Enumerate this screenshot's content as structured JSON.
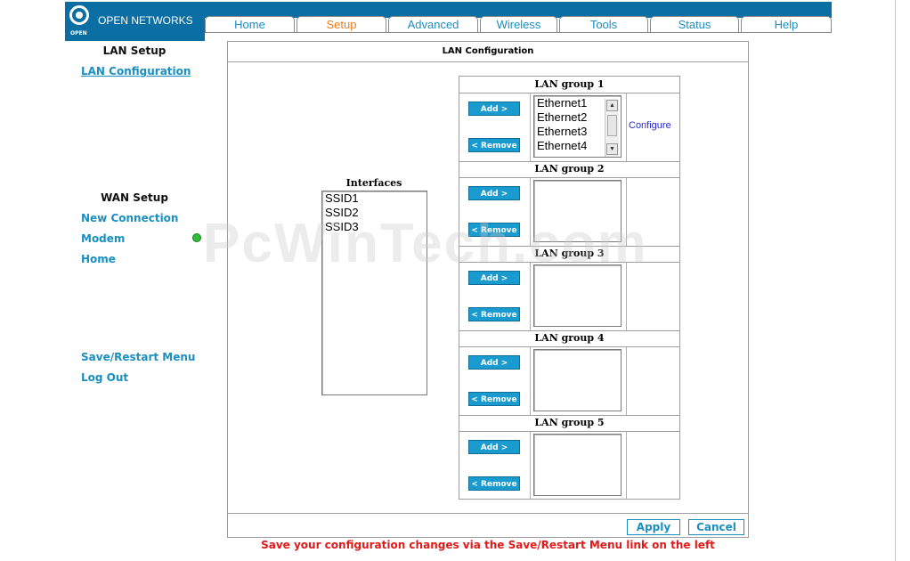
{
  "brand": {
    "name": "OPEN NETWORKS",
    "logo_text": "OPEN"
  },
  "tabs": [
    {
      "label": "Home",
      "active": false
    },
    {
      "label": "Setup",
      "active": true
    },
    {
      "label": "Advanced",
      "active": false
    },
    {
      "label": "Wireless",
      "active": false
    },
    {
      "label": "Tools",
      "active": false
    },
    {
      "label": "Status",
      "active": false
    },
    {
      "label": "Help",
      "active": false
    }
  ],
  "sidebar": {
    "lan_heading": "LAN Setup",
    "lan_configuration": "LAN Configuration",
    "wan_heading": "WAN Setup",
    "new_connection": "New Connection",
    "modem": "Modem",
    "home": "Home",
    "save_restart": "Save/Restart Menu",
    "log_out": "Log Out"
  },
  "main": {
    "title": "LAN Configuration",
    "interfaces_title": "Interfaces",
    "interfaces": [
      "SSID1",
      "SSID2",
      "SSID3"
    ],
    "add_label": "Add >",
    "remove_label": "< Remove",
    "configure_label": "Configure",
    "groups": [
      {
        "name": "LAN group 1",
        "members": [
          "Ethernet1",
          "Ethernet2",
          "Ethernet3",
          "Ethernet4"
        ]
      },
      {
        "name": "LAN group 2",
        "members": []
      },
      {
        "name": "LAN group 3",
        "members": []
      },
      {
        "name": "LAN group 4",
        "members": []
      },
      {
        "name": "LAN group 5",
        "members": []
      }
    ],
    "apply_label": "Apply",
    "cancel_label": "Cancel",
    "notice": "Save your configuration changes via the Save/Restart Menu link on the left"
  },
  "watermark": "PcWinTech.com",
  "colors": {
    "brand_blue": "#0b6fa4",
    "link_blue": "#1a8fc0",
    "active_tab": "#f07b16",
    "notice_red": "#e01b1b",
    "status_green": "#2fbf3a"
  }
}
